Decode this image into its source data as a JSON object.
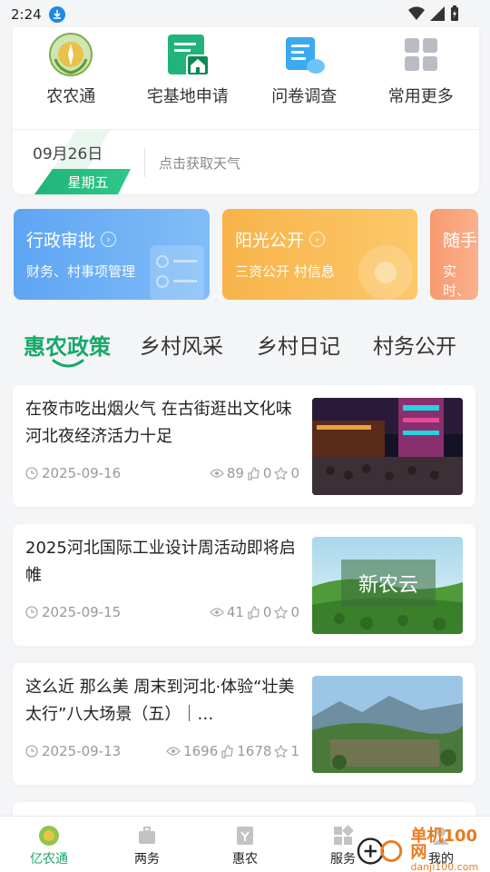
{
  "status_bar": {
    "time": "2:24"
  },
  "quick_actions": [
    {
      "label": "农农通",
      "icon": "emblem-icon"
    },
    {
      "label": "宅基地申请",
      "icon": "house-doc-icon"
    },
    {
      "label": "问卷调查",
      "icon": "survey-icon"
    },
    {
      "label": "常用更多",
      "icon": "grid-icon"
    }
  ],
  "weather": {
    "date": "09月26日",
    "weekday": "星期五",
    "hint": "点击获取天气"
  },
  "services": [
    {
      "title": "行政审批",
      "subtitle": "财务、村事项管理",
      "color": "#66aaf4"
    },
    {
      "title": "阳光公开",
      "subtitle": "三资公开 村信息",
      "color": "#f9b94f"
    },
    {
      "title": "随手",
      "subtitle": "实时、",
      "color": "#f99e73"
    }
  ],
  "tabs": [
    {
      "label": "惠农政策",
      "active": true
    },
    {
      "label": "乡村风采",
      "active": false
    },
    {
      "label": "乡村日记",
      "active": false
    },
    {
      "label": "村务公开",
      "active": false
    }
  ],
  "news": [
    {
      "title": "在夜市吃出烟火气 在古街逛出文化味 河北夜经济活力十足",
      "date": "2025-09-16",
      "views": "89",
      "likes": "0",
      "favs": "0"
    },
    {
      "title": "2025河北国际工业设计周活动即将启帷",
      "date": "2025-09-15",
      "views": "41",
      "likes": "0",
      "favs": "0",
      "thumb_text": "新农云"
    },
    {
      "title": "这么近 那么美 周末到河北·体验“壮美太行”八大场景（五）｜…",
      "date": "2025-09-13",
      "views": "1696",
      "likes": "1678",
      "favs": "1"
    }
  ],
  "bottom_nav": [
    {
      "label": "亿农通",
      "icon": "emblem-icon",
      "active": true
    },
    {
      "label": "两务",
      "icon": "briefcase-icon",
      "active": false
    },
    {
      "label": "惠农",
      "icon": "benefit-icon",
      "active": false
    },
    {
      "label": "服务",
      "icon": "grid-icon",
      "active": false
    },
    {
      "label": "我的",
      "icon": "person-icon",
      "active": false
    }
  ],
  "watermark": {
    "brand": "单机100网",
    "url": "danji100.com"
  },
  "colors": {
    "accent": "#17a86a",
    "background": "#f4f5f7"
  }
}
